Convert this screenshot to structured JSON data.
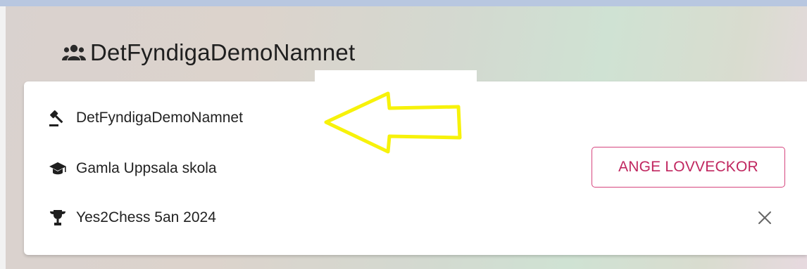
{
  "header": {
    "team_title": "DetFyndigaDemoNamnet",
    "team_icon": "users-group-icon"
  },
  "rows": [
    {
      "icon": "gavel-icon",
      "label": "DetFyndigaDemoNamnet"
    },
    {
      "icon": "graduation-cap-icon",
      "label": "Gamla Uppsala skola"
    },
    {
      "icon": "trophy-icon",
      "label": "Yes2Chess 5an 2024"
    }
  ],
  "actions": {
    "ange_label": "ANGE LOVVECKOR",
    "close_icon": "close-icon"
  },
  "annotation": {
    "arrow_color": "#f7f20a",
    "arrow_icon": "arrow-left-outline"
  },
  "colors": {
    "accent": "#c0265f",
    "text": "#222222",
    "top_strip": "#b8c7e0"
  }
}
